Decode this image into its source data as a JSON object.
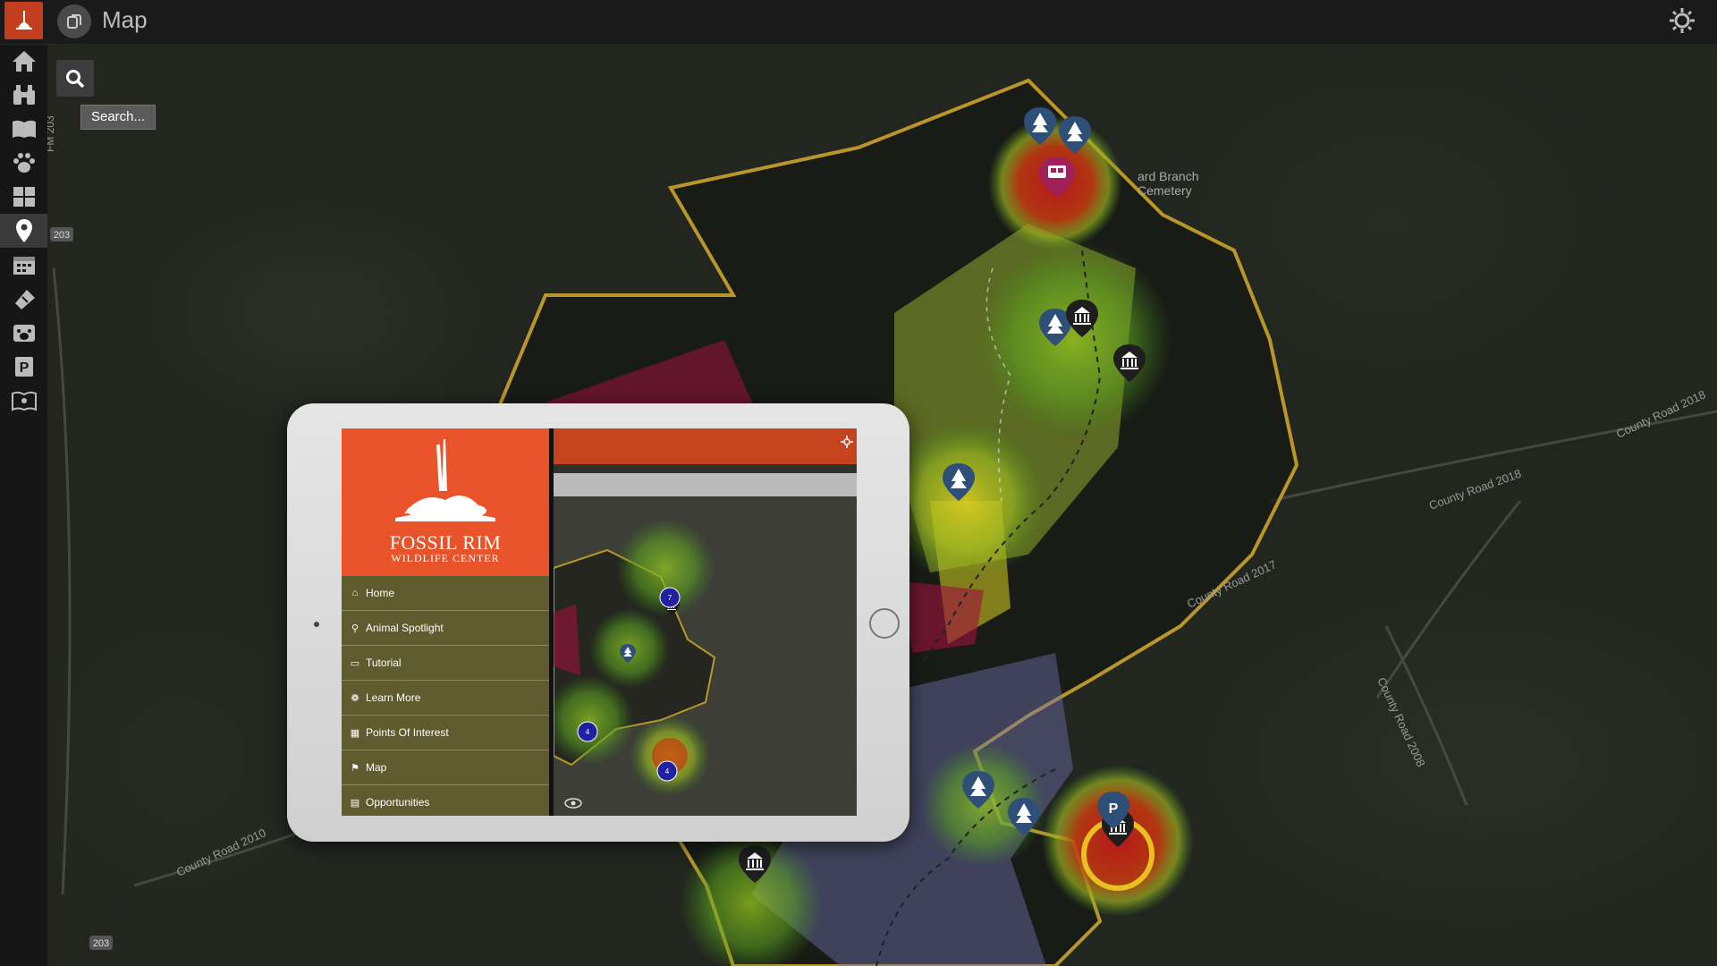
{
  "header": {
    "title": "Map"
  },
  "search": {
    "label": "Search..."
  },
  "sidebar": {
    "items": [
      {
        "icon": "home-icon"
      },
      {
        "icon": "binoculars-icon"
      },
      {
        "icon": "book-icon"
      },
      {
        "icon": "paw-icon"
      },
      {
        "icon": "grid-icon"
      },
      {
        "icon": "map-pin-icon"
      },
      {
        "icon": "calendar-icon"
      },
      {
        "icon": "ticket-icon"
      },
      {
        "icon": "animal-icon"
      },
      {
        "icon": "parking-icon"
      },
      {
        "icon": "guidebook-icon"
      }
    ]
  },
  "map_labels": {
    "cemetery": "ard Branch\nCemetery",
    "road1": "County Road 2018",
    "road2": "County Road 2018",
    "road3": "County Road 2008",
    "road4": "County Road 2010",
    "road5": "County Road 2017",
    "fm203": "FM 203",
    "shield1": "203",
    "shield2": "203"
  },
  "tablet": {
    "brand": "FOSSIL RIM",
    "brand_sub": "WILDLIFE CENTER",
    "menu": [
      {
        "label": "Home",
        "icon": "home-icon"
      },
      {
        "label": "Animal Spotlight",
        "icon": "binoculars-icon"
      },
      {
        "label": "Tutorial",
        "icon": "book-icon"
      },
      {
        "label": "Learn More",
        "icon": "paw-icon"
      },
      {
        "label": "Points Of Interest",
        "icon": "grid-icon"
      },
      {
        "label": "Map",
        "icon": "map-pin-icon"
      },
      {
        "label": "Opportunities",
        "icon": "calendar-icon"
      }
    ],
    "clusters": [
      "7",
      "4",
      "4"
    ]
  },
  "colors": {
    "accent": "#c33e1f",
    "tablet_brand": "#e8532a",
    "menu_bg": "#5e5b2f",
    "boundary": "#b8962a"
  }
}
